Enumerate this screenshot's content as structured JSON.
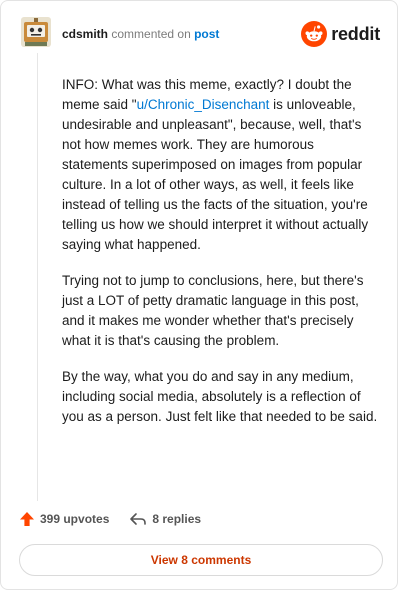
{
  "header": {
    "username": "cdsmith",
    "action_text": "commented on",
    "target_link": "post",
    "brand": "reddit"
  },
  "comment": {
    "p1_before": "INFO: What was this meme, exactly? I doubt the meme said \"",
    "p1_mention": "u/Chronic_Disenchant",
    "p1_after": " is unloveable, undesirable and unpleasant\", because, well, that's not how memes work. They are humorous statements superimposed on images from popular culture. In a lot of other ways, as well, it feels like instead of telling us the facts of the situation, you're telling us how we should interpret it without actually saying what happened.",
    "p2": "Trying not to jump to conclusions, here, but there's just a LOT of petty dramatic language in this post, and it makes me wonder whether that's precisely what it is that's causing the problem.",
    "p3": "By the way, what you do and say in any medium, including social media, absolutely is a reflection of you as a person. Just felt like that needed to be said."
  },
  "actions": {
    "upvotes": "399 upvotes",
    "replies": "8 replies",
    "view_comments": "View 8 comments"
  },
  "colors": {
    "accent": "#ff4500",
    "link": "#0079d3",
    "button_text": "#cc3700"
  },
  "icons": {
    "avatar": "robot-avatar-icon",
    "brand": "reddit-logo-icon",
    "upvote": "upvote-arrow-icon",
    "reply": "reply-arrow-icon"
  }
}
